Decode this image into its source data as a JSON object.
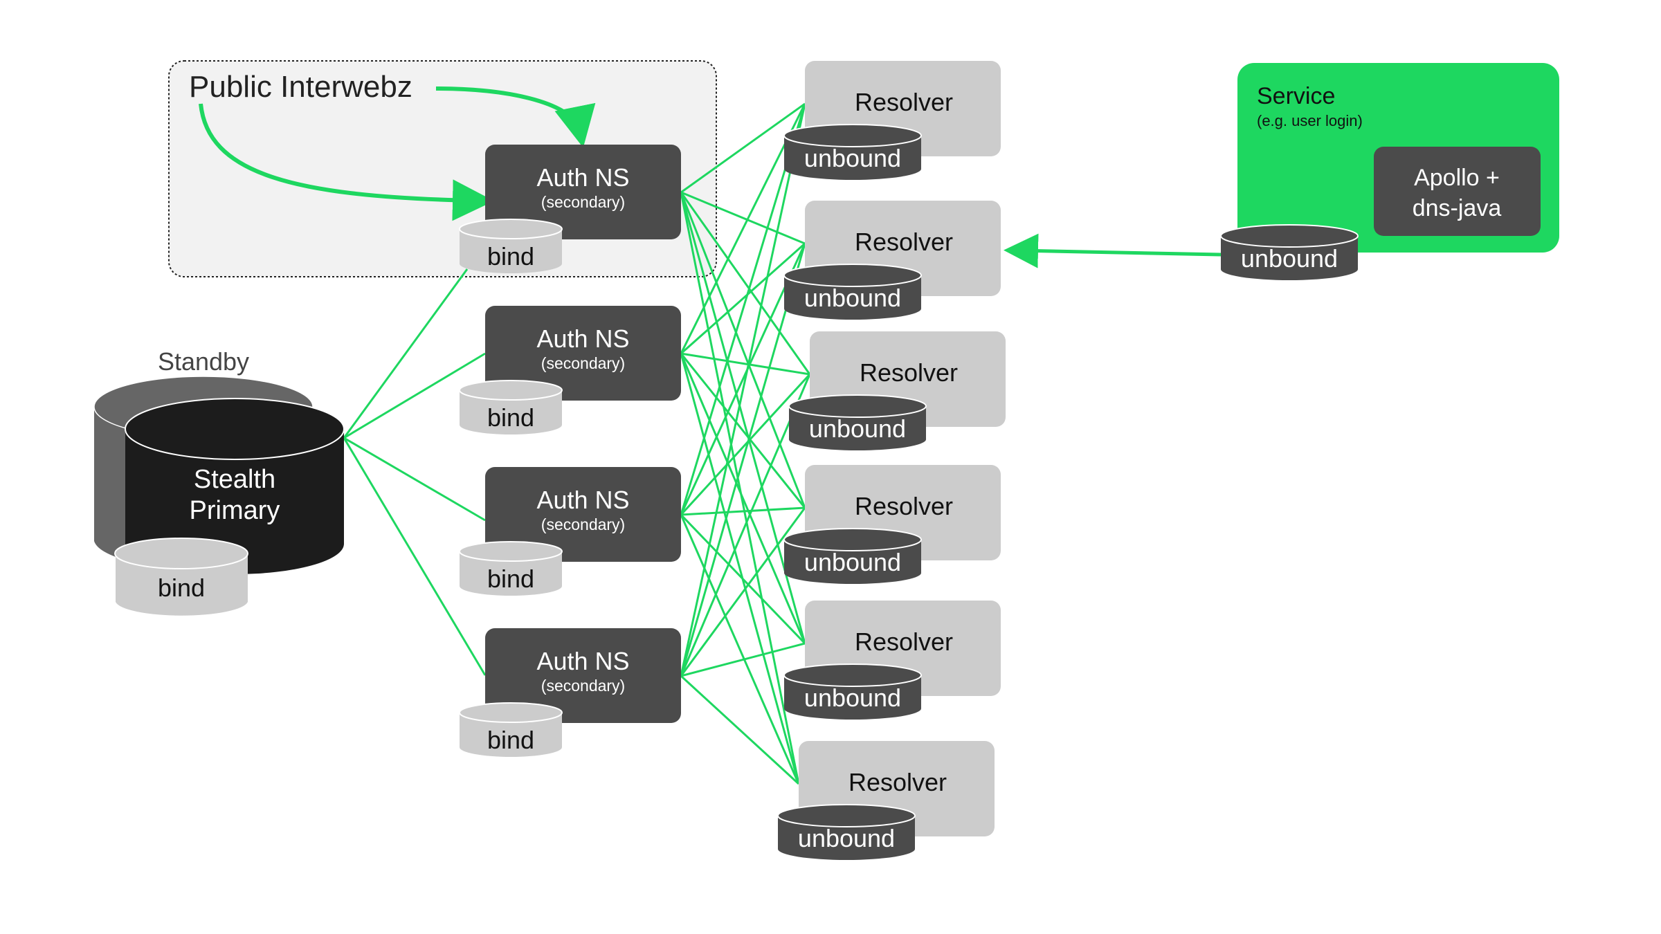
{
  "colors": {
    "accent_green": "#1ed760",
    "auth_box": "#4b4b4b",
    "resolver_box": "#cccccc",
    "primary_db": "#1c1c1c",
    "standby_db": "#666666",
    "public_zone_bg": "#f2f2f2"
  },
  "public_zone": {
    "title": "Public Interwebz"
  },
  "primary": {
    "standby_label": "Standby",
    "title_line1": "Stealth",
    "title_line2": "Primary",
    "db_label": "bind"
  },
  "auth_servers": [
    {
      "title": "Auth NS",
      "subtitle": "(secondary)",
      "db_label": "bind",
      "public": true
    },
    {
      "title": "Auth NS",
      "subtitle": "(secondary)",
      "db_label": "bind",
      "public": false
    },
    {
      "title": "Auth NS",
      "subtitle": "(secondary)",
      "db_label": "bind",
      "public": false
    },
    {
      "title": "Auth NS",
      "subtitle": "(secondary)",
      "db_label": "bind",
      "public": false
    }
  ],
  "resolvers": [
    {
      "title": "Resolver",
      "db_label": "unbound"
    },
    {
      "title": "Resolver",
      "db_label": "unbound"
    },
    {
      "title": "Resolver",
      "db_label": "unbound"
    },
    {
      "title": "Resolver",
      "db_label": "unbound"
    },
    {
      "title": "Resolver",
      "db_label": "unbound"
    },
    {
      "title": "Resolver",
      "db_label": "unbound"
    }
  ],
  "service": {
    "title": "Service",
    "subtitle": "(e.g. user login)",
    "client_line1": "Apollo +",
    "client_line2": "dns-java",
    "db_label": "unbound"
  },
  "edges": {
    "primary_to_auth": [
      0,
      1,
      2,
      3
    ],
    "auth_to_resolver": "all-to-all",
    "internet_to_auth": [
      0
    ],
    "service_to_resolver": 1
  }
}
